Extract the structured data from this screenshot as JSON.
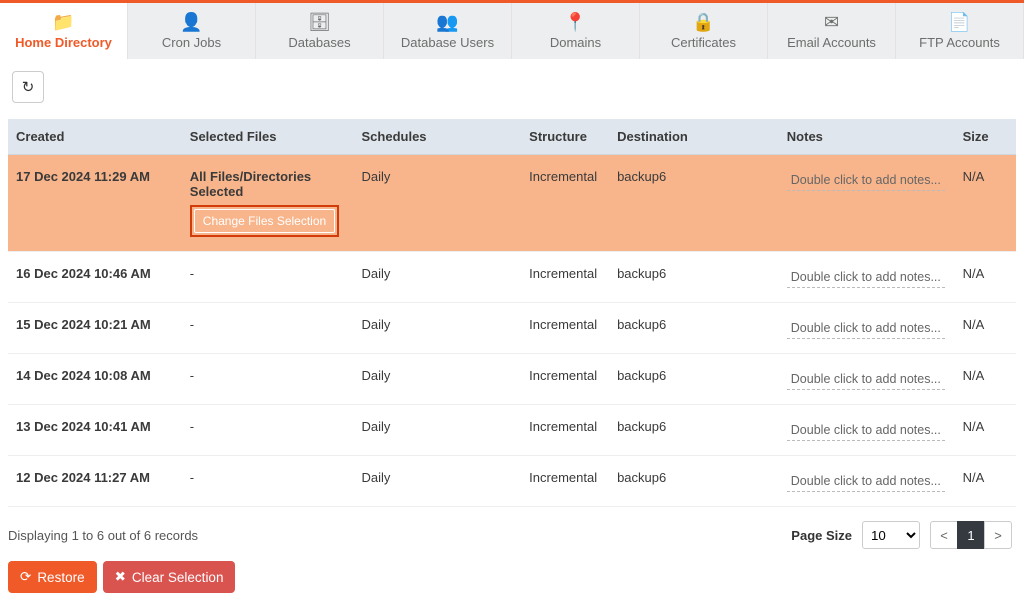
{
  "tabs": [
    {
      "label": "Home Directory",
      "icon": "📁",
      "active": true
    },
    {
      "label": "Cron Jobs",
      "icon": "👤",
      "active": false
    },
    {
      "label": "Databases",
      "icon": "🗄",
      "active": false
    },
    {
      "label": "Database Users",
      "icon": "👥",
      "active": false
    },
    {
      "label": "Domains",
      "icon": "📍",
      "active": false
    },
    {
      "label": "Certificates",
      "icon": "🔒",
      "active": false
    },
    {
      "label": "Email Accounts",
      "icon": "✉",
      "active": false
    },
    {
      "label": "FTP Accounts",
      "icon": "📄",
      "active": false
    }
  ],
  "columns": {
    "created": "Created",
    "selected_files": "Selected Files",
    "schedules": "Schedules",
    "structure": "Structure",
    "destination": "Destination",
    "notes": "Notes",
    "size": "Size"
  },
  "change_files_label": "Change Files Selection",
  "notes_placeholder": "Double click to add notes...",
  "rows": [
    {
      "created": "17 Dec 2024 11:29 AM",
      "selected_files": "All Files/Directories Selected",
      "schedules": "Daily",
      "structure": "Incremental",
      "destination": "backup6",
      "size": "N/A",
      "selected": true,
      "show_change": true
    },
    {
      "created": "16 Dec 2024 10:46 AM",
      "selected_files": "-",
      "schedules": "Daily",
      "structure": "Incremental",
      "destination": "backup6",
      "size": "N/A",
      "selected": false,
      "show_change": false
    },
    {
      "created": "15 Dec 2024 10:21 AM",
      "selected_files": "-",
      "schedules": "Daily",
      "structure": "Incremental",
      "destination": "backup6",
      "size": "N/A",
      "selected": false,
      "show_change": false
    },
    {
      "created": "14 Dec 2024 10:08 AM",
      "selected_files": "-",
      "schedules": "Daily",
      "structure": "Incremental",
      "destination": "backup6",
      "size": "N/A",
      "selected": false,
      "show_change": false
    },
    {
      "created": "13 Dec 2024 10:41 AM",
      "selected_files": "-",
      "schedules": "Daily",
      "structure": "Incremental",
      "destination": "backup6",
      "size": "N/A",
      "selected": false,
      "show_change": false
    },
    {
      "created": "12 Dec 2024 11:27 AM",
      "selected_files": "-",
      "schedules": "Daily",
      "structure": "Incremental",
      "destination": "backup6",
      "size": "N/A",
      "selected": false,
      "show_change": false
    }
  ],
  "footer": {
    "displaying": "Displaying 1 to 6 out of 6 records",
    "page_size_label": "Page Size",
    "page_size_value": "10",
    "prev": "<",
    "next": ">",
    "current_page": "1"
  },
  "actions": {
    "restore": "Restore",
    "clear": "Clear Selection"
  }
}
